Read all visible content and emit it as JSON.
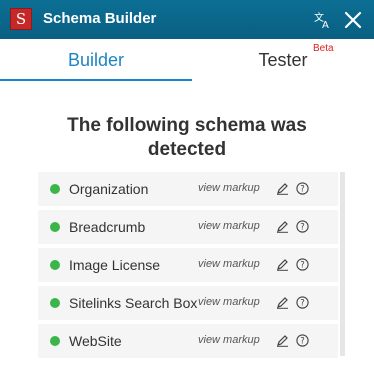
{
  "app": {
    "logo_letter": "S",
    "title": "Schema Builder"
  },
  "header_icons": {
    "translate": "translate-icon",
    "close": "close-icon"
  },
  "tabs": {
    "builder": "Builder",
    "tester": "Tester",
    "tester_badge": "Beta"
  },
  "heading": "The following schema was detected",
  "schemas": [
    {
      "name": "Organization",
      "action": "view markup"
    },
    {
      "name": "Breadcrumb",
      "action": "view markup"
    },
    {
      "name": "Image License",
      "action": "view markup"
    },
    {
      "name": "Sitelinks Search Box",
      "action": "view markup"
    },
    {
      "name": "WebSite",
      "action": "view markup"
    }
  ],
  "colors": {
    "accent": "#1f84c5",
    "header": "#0a5f82",
    "status_ok": "#3bb54a",
    "logo": "#c62828"
  }
}
